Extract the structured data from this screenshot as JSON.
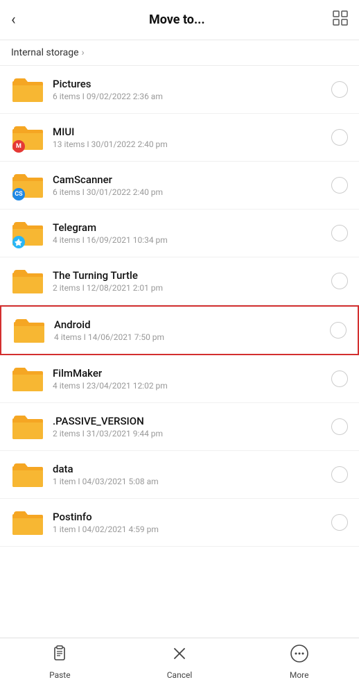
{
  "header": {
    "title": "Move to...",
    "back_label": "‹",
    "grid_icon": "⊞"
  },
  "breadcrumb": {
    "text": "Internal storage",
    "chevron": "›"
  },
  "folders": [
    {
      "name": "Pictures",
      "meta": "6 items  I  09/02/2022 2:36 am",
      "badge": null,
      "highlighted": false
    },
    {
      "name": "MIUI",
      "meta": "13 items  I  30/01/2022 2:40 pm",
      "badge": "miui",
      "highlighted": false
    },
    {
      "name": "CamScanner",
      "meta": "6 items  I  30/01/2022 2:40 pm",
      "badge": "cs",
      "highlighted": false
    },
    {
      "name": "Telegram",
      "meta": "4 items  I  16/09/2021 10:34 pm",
      "badge": "telegram",
      "highlighted": false
    },
    {
      "name": "The Turning Turtle",
      "meta": "2 items  I  12/08/2021 2:01 pm",
      "badge": null,
      "highlighted": false
    },
    {
      "name": "Android",
      "meta": "4 items  I  14/06/2021 7:50 pm",
      "badge": null,
      "highlighted": true
    },
    {
      "name": "FilmMaker",
      "meta": "4 items  I  23/04/2021 12:02 pm",
      "badge": null,
      "highlighted": false
    },
    {
      "name": ".PASSIVE_VERSION",
      "meta": "2 items  I  31/03/2021 9:44 pm",
      "badge": null,
      "highlighted": false
    },
    {
      "name": "data",
      "meta": "1 item  I  04/03/2021 5:08 am",
      "badge": null,
      "highlighted": false
    },
    {
      "name": "Postinfo",
      "meta": "1 item  I  04/02/2021 4:59 pm",
      "badge": null,
      "highlighted": false
    }
  ],
  "bottom_actions": [
    {
      "id": "paste",
      "label": "Paste",
      "icon": "paste"
    },
    {
      "id": "cancel",
      "label": "Cancel",
      "icon": "cancel"
    },
    {
      "id": "more",
      "label": "More",
      "icon": "more"
    }
  ]
}
